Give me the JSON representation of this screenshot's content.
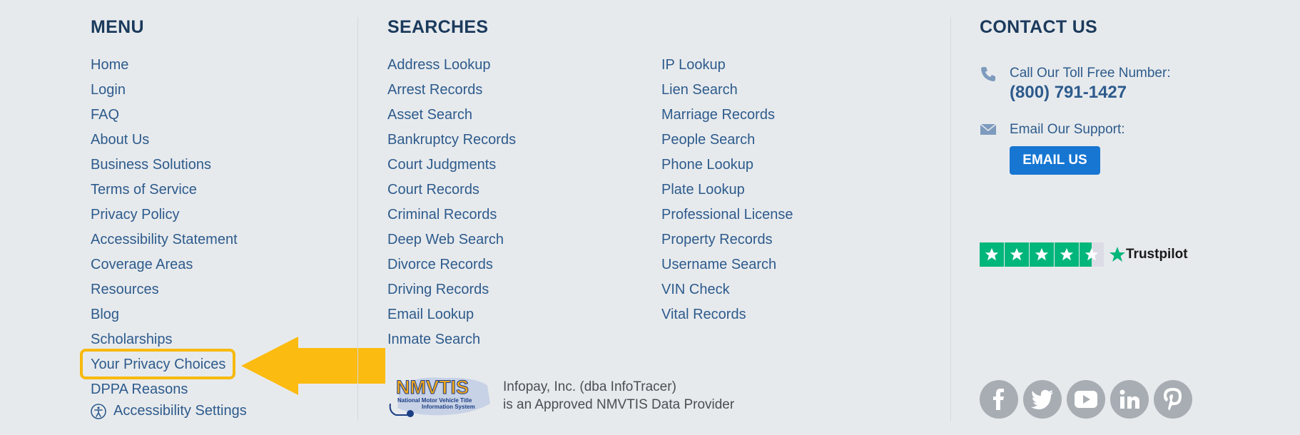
{
  "menu": {
    "heading": "MENU",
    "items": [
      {
        "label": "Home"
      },
      {
        "label": "Login"
      },
      {
        "label": "FAQ"
      },
      {
        "label": "About Us"
      },
      {
        "label": "Business Solutions"
      },
      {
        "label": "Terms of Service"
      },
      {
        "label": "Privacy Policy"
      },
      {
        "label": "Accessibility Statement"
      },
      {
        "label": "Coverage Areas"
      },
      {
        "label": "Resources"
      },
      {
        "label": "Blog"
      },
      {
        "label": "Scholarships"
      },
      {
        "label": "Your Privacy Choices"
      },
      {
        "label": "DPPA Reasons"
      }
    ],
    "accessibility_settings": "Accessibility Settings"
  },
  "searches": {
    "heading": "SEARCHES",
    "col1": [
      "Address Lookup",
      "Arrest Records",
      "Asset Search",
      "Bankruptcy Records",
      "Court Judgments",
      "Court Records",
      "Criminal Records",
      "Deep Web Search",
      "Divorce Records",
      "Driving Records",
      "Email Lookup",
      "Inmate Search"
    ],
    "col2": [
      "IP Lookup",
      "Lien Search",
      "Marriage Records",
      "People Search",
      "Phone Lookup",
      "Plate Lookup",
      "Professional License",
      "Property Records",
      "Username Search",
      "VIN Check",
      "Vital Records"
    ],
    "nmvtis": {
      "logo_text": "NMVTIS",
      "logo_sub1": "National Motor Vehicle Title",
      "logo_sub2": "Information System",
      "line1": "Infopay, Inc. (dba InfoTracer)",
      "line2": "is an Approved NMVTIS Data Provider"
    }
  },
  "contact": {
    "heading": "CONTACT US",
    "call_label": "Call Our Toll Free Number:",
    "phone": "(800) 791-1427",
    "email_label": "Email Our Support:",
    "email_button": "EMAIL US",
    "trustpilot": "Trustpilot",
    "trustpilot_rating": 4.5,
    "socials": [
      "facebook",
      "twitter",
      "youtube",
      "linkedin",
      "pinterest"
    ]
  },
  "colors": {
    "background": "#e7eaed",
    "link": "#2d5b8c",
    "heading": "#1b3a5c",
    "highlight": "#f7b90c",
    "button": "#1676d2",
    "trustpilot_green": "#00b67a",
    "social_gray": "#a7adb3"
  }
}
